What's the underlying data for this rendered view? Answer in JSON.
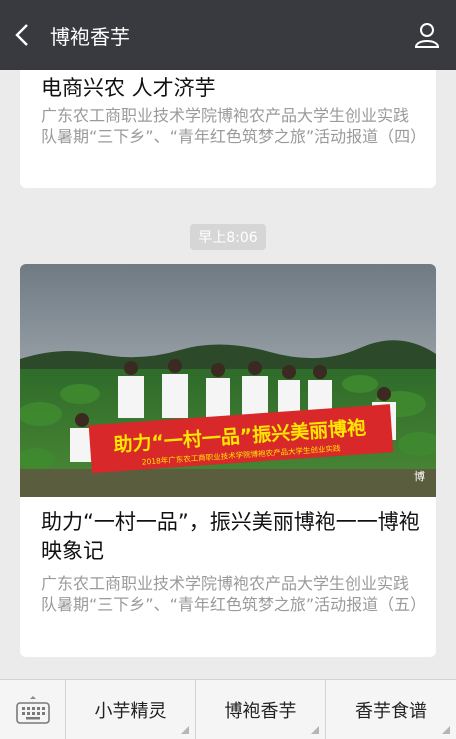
{
  "header": {
    "title": "博袍香芋",
    "back_icon": "chevron-left-icon",
    "profile_icon": "person-icon"
  },
  "articles": [
    {
      "title": "电商兴农  人才济芋",
      "description": "广东农工商职业技术学院博袍农产品大学生创业实践队暑期“三下乡”、“青年红色筑梦之旅”活动报道（四）"
    },
    {
      "time": "早上8:06",
      "image": {
        "banner_main": "助力“一村一品”振兴美丽博袍",
        "banner_sub": "2018年广东农工商职业技术学院博袍农产品大学生创业实践",
        "watermark": "博"
      },
      "title": "助力“一村一品”，振兴美丽博袍一一博袍映象记",
      "description": "广东农工商职业技术学院博袍农产品大学生创业实践队暑期“三下乡”、“青年红色筑梦之旅”活动报道（五）"
    }
  ],
  "bottom_menu": {
    "keyboard_icon": "keyboard-icon",
    "items": [
      "小芋精灵",
      "博袍香芋",
      "香芋食谱"
    ]
  },
  "colors": {
    "header_bg": "#393a3f",
    "page_bg": "#ebebeb",
    "banner_red": "#d8282a",
    "banner_text": "#ffe600"
  }
}
